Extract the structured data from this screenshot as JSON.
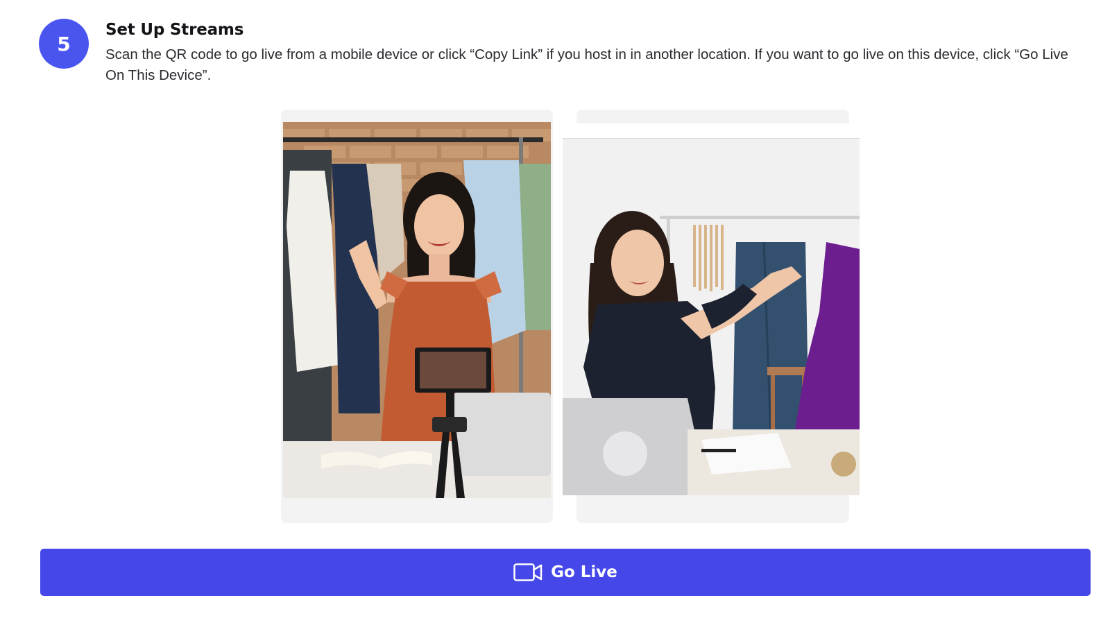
{
  "step": {
    "number": "5",
    "title": "Set Up Streams",
    "description": "Scan the QR code to go live from a mobile device or click “Copy Link” if you host in in another location. If you want to go live on this device, click “Go Live On This Device”.",
    "badge_color": "#4a55f0"
  },
  "options": [
    {
      "image": "woman-waving-at-phone-camera-photo",
      "card_color": "#f3f3f4"
    },
    {
      "image": "woman-holding-garment-at-laptop-photo",
      "card_color": "#f3f3f4"
    }
  ],
  "go_live_button": {
    "label": "Go Live",
    "icon": "video-camera-icon",
    "color": "#4547e8"
  }
}
